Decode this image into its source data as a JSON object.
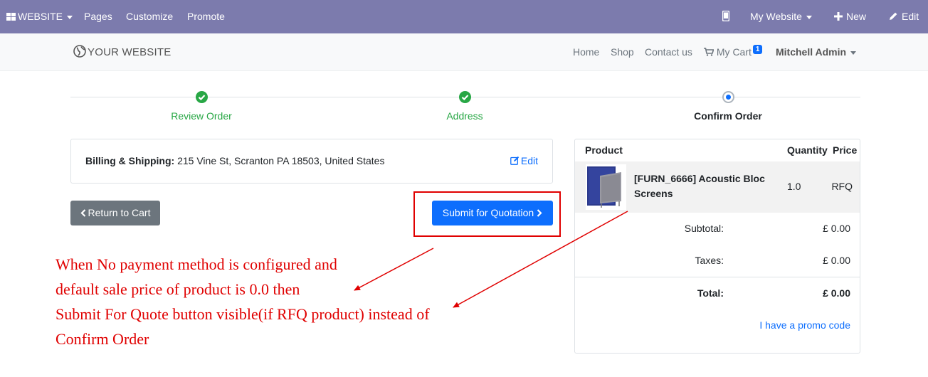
{
  "admin_bar": {
    "website_menu": "WEBSITE",
    "pages": "Pages",
    "customize": "Customize",
    "promote": "Promote",
    "my_website": "My Website",
    "new": "New",
    "edit": "Edit"
  },
  "header": {
    "logo": "YOUR WEBSITE",
    "nav": [
      "Home",
      "Shop",
      "Contact us"
    ],
    "cart_label": "My Cart",
    "cart_count": "1",
    "user": "Mitchell Admin"
  },
  "wizard": {
    "steps": [
      {
        "label": "Review Order",
        "state": "done"
      },
      {
        "label": "Address",
        "state": "done"
      },
      {
        "label": "Confirm Order",
        "state": "current"
      }
    ]
  },
  "billing": {
    "label": "Billing & Shipping:",
    "address": "215 Vine St, Scranton PA 18503, United States",
    "edit": "Edit"
  },
  "actions": {
    "return": "Return to Cart",
    "submit": "Submit for Quotation"
  },
  "annotation": {
    "lines": [
      "When No payment method is configured and",
      "default sale price of product is 0.0 then",
      "Submit For Quote button visible(if RFQ product) instead of",
      "Confirm Order"
    ]
  },
  "summary": {
    "headers": {
      "product": "Product",
      "quantity": "Quantity",
      "price": "Price"
    },
    "product": {
      "name": "[FURN_6666] Acoustic Bloc Screens",
      "quantity": "1.0",
      "price": "RFQ"
    },
    "subtotal_label": "Subtotal:",
    "subtotal": "£ 0.00",
    "taxes_label": "Taxes:",
    "taxes": "£ 0.00",
    "total_label": "Total:",
    "total": "£ 0.00",
    "promo": "I have a promo code"
  },
  "colors": {
    "admin_bar": "#7c7bad",
    "success": "#28a745",
    "primary": "#0d6efd",
    "annotation": "#e00000"
  }
}
